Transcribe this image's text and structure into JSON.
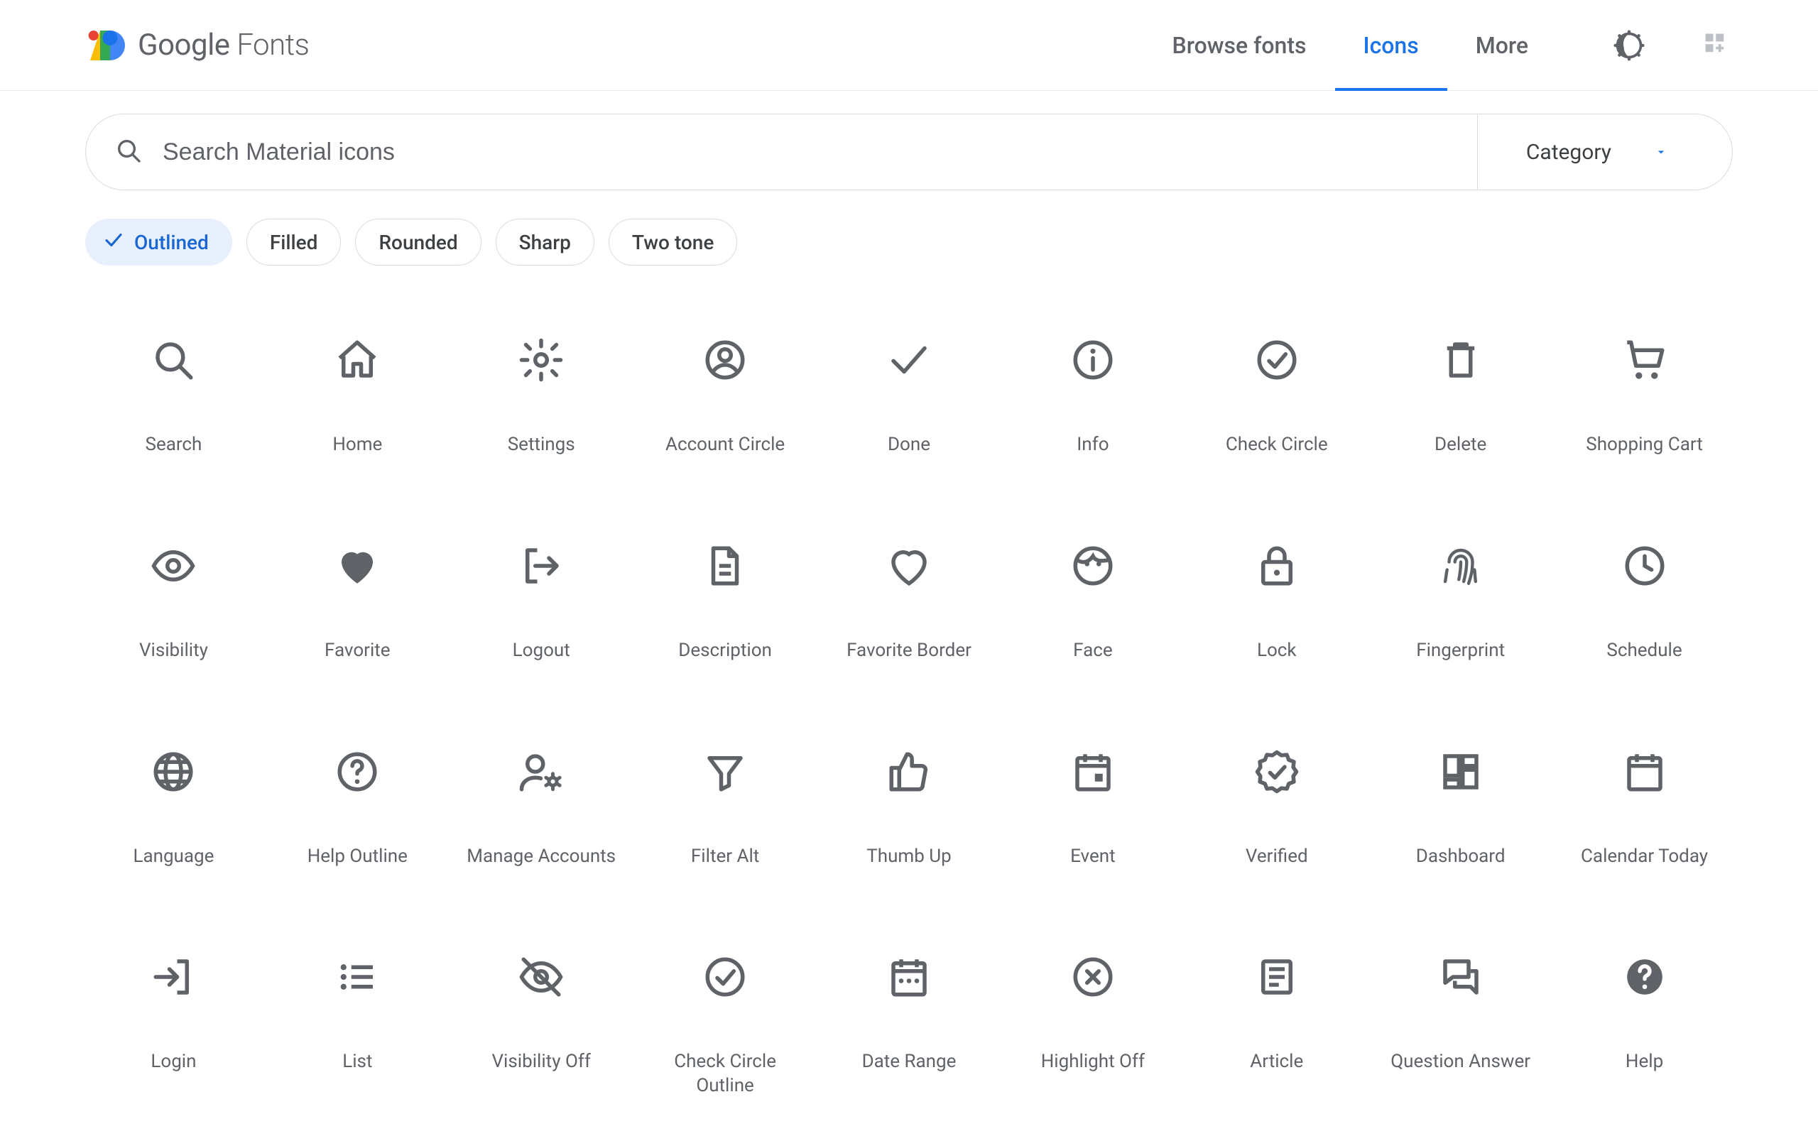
{
  "header": {
    "brand_google": "Google",
    "brand_fonts": " Fonts",
    "nav": {
      "browse": "Browse fonts",
      "icons": "Icons",
      "more": "More"
    }
  },
  "search": {
    "placeholder": "Search Material icons",
    "category_label": "Category"
  },
  "styles": {
    "outlined": "Outlined",
    "filled": "Filled",
    "rounded": "Rounded",
    "sharp": "Sharp",
    "twotone": "Two tone"
  },
  "icons": [
    {
      "id": "search",
      "label": "Search"
    },
    {
      "id": "home",
      "label": "Home"
    },
    {
      "id": "settings",
      "label": "Settings"
    },
    {
      "id": "account_circle",
      "label": "Account Circle"
    },
    {
      "id": "done",
      "label": "Done"
    },
    {
      "id": "info",
      "label": "Info"
    },
    {
      "id": "check_circle",
      "label": "Check Circle"
    },
    {
      "id": "delete",
      "label": "Delete"
    },
    {
      "id": "shopping_cart",
      "label": "Shopping Cart"
    },
    {
      "id": "visibility",
      "label": "Visibility"
    },
    {
      "id": "favorite",
      "label": "Favorite"
    },
    {
      "id": "logout",
      "label": "Logout"
    },
    {
      "id": "description",
      "label": "Description"
    },
    {
      "id": "favorite_border",
      "label": "Favorite Border"
    },
    {
      "id": "face",
      "label": "Face"
    },
    {
      "id": "lock",
      "label": "Lock"
    },
    {
      "id": "fingerprint",
      "label": "Fingerprint"
    },
    {
      "id": "schedule",
      "label": "Schedule"
    },
    {
      "id": "language",
      "label": "Language"
    },
    {
      "id": "help_outline",
      "label": "Help Outline"
    },
    {
      "id": "manage_accounts",
      "label": "Manage Accounts"
    },
    {
      "id": "filter_alt",
      "label": "Filter Alt"
    },
    {
      "id": "thumb_up",
      "label": "Thumb Up"
    },
    {
      "id": "event",
      "label": "Event"
    },
    {
      "id": "verified",
      "label": "Verified"
    },
    {
      "id": "dashboard",
      "label": "Dashboard"
    },
    {
      "id": "calendar_today",
      "label": "Calendar Today"
    },
    {
      "id": "login",
      "label": "Login"
    },
    {
      "id": "list",
      "label": "List"
    },
    {
      "id": "visibility_off",
      "label": "Visibility Off"
    },
    {
      "id": "check_circle_outline",
      "label": "Check Circle Outline"
    },
    {
      "id": "date_range",
      "label": "Date Range"
    },
    {
      "id": "highlight_off",
      "label": "Highlight Off"
    },
    {
      "id": "article",
      "label": "Article"
    },
    {
      "id": "question_answer",
      "label": "Question Answer"
    },
    {
      "id": "help",
      "label": "Help"
    }
  ]
}
